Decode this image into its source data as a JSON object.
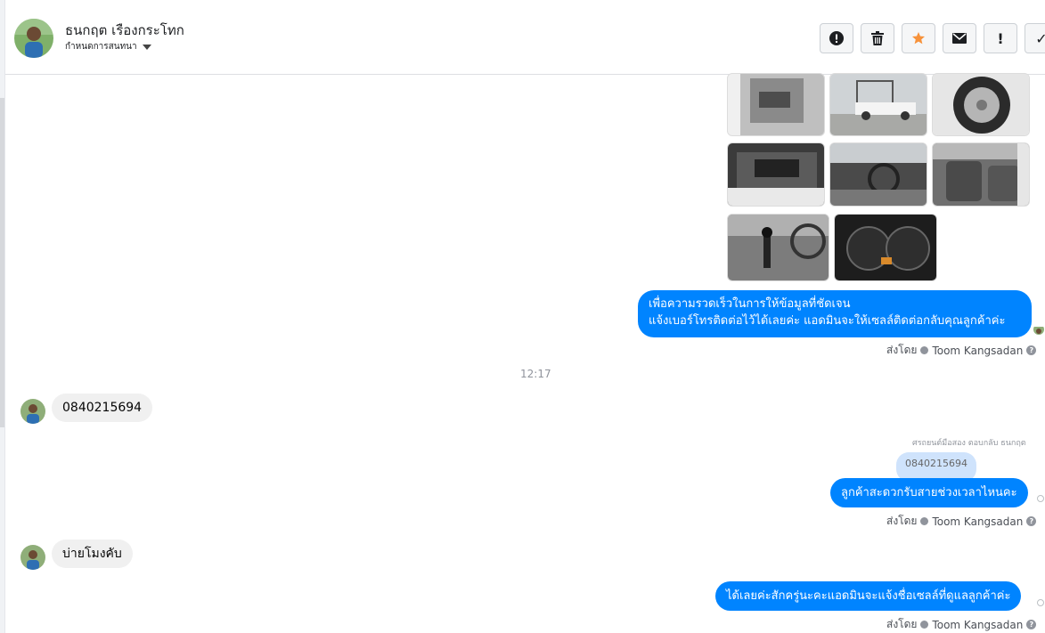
{
  "header": {
    "name": "ธนกฤต เรืองกระโทก",
    "subtitle": "กำหนดการสนทนา",
    "actions": [
      {
        "icon": "alert-circle-icon",
        "label": ""
      },
      {
        "icon": "trash-icon",
        "label": ""
      },
      {
        "icon": "star-icon",
        "label": ""
      },
      {
        "icon": "envelope-icon",
        "label": ""
      },
      {
        "icon": "exclamation-icon",
        "label": "!"
      },
      {
        "icon": "check-icon",
        "label": "✓"
      }
    ]
  },
  "colors": {
    "outgoing_bubble": "#0084ff",
    "incoming_bubble": "#f0f0f0",
    "star": "#f7923a"
  },
  "messages": {
    "out1": {
      "line1": "เพื่อความรวดเร็วในการให้ข้อมูลที่ชัดเจน",
      "line2": "แจ้งเบอร์โทรติดต่อไว้ได้เลยค่ะ แอดมินจะให้เซลล์ติดต่อกลับคุณลูกค้าค่ะ",
      "sent_by_label": "ส่งโดย",
      "sender": "Toom Kangsadan"
    },
    "time": "12:17",
    "in1": {
      "text": "0840215694"
    },
    "out2": {
      "reply_note": "ศรถยนต์มือสอง ตอบกลับ ธนกฤต",
      "quoted": "0840215694",
      "text": "ลูกค้าสะดวกรับสายช่วงเวลาไหนคะ",
      "sent_by_label": "ส่งโดย",
      "sender": "Toom Kangsadan"
    },
    "in2": {
      "text": "บ่ายโมงคับ"
    },
    "out3": {
      "text": "ได้เลยค่ะสักครู่นะคะแอดมินจะแจ้งชื่อเซลล์ที่ดูแลลูกค้าค่ะ",
      "sent_by_label": "ส่งโดย",
      "sender": "Toom Kangsadan"
    }
  },
  "help_glyph": "?"
}
